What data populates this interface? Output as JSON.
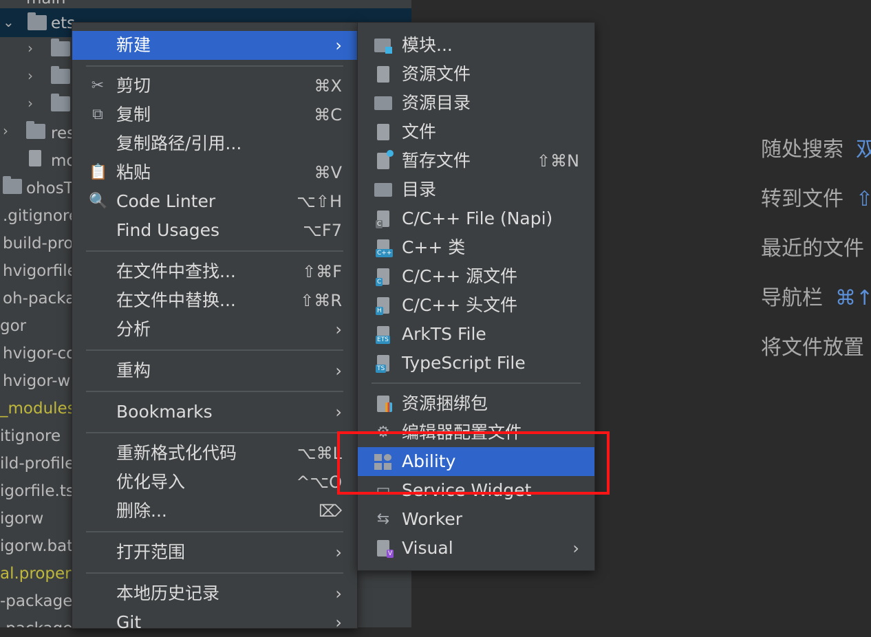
{
  "project_tree": {
    "items": [
      {
        "label": "main",
        "indent": 38,
        "folder": false
      },
      {
        "label": "ets",
        "indent": 74,
        "folder": true
      },
      {
        "label": "",
        "indent": 100,
        "folder": true
      },
      {
        "label": "",
        "indent": 100,
        "folder": true
      },
      {
        "label": "",
        "indent": 100,
        "folder": true
      },
      {
        "label": "res",
        "indent": 74,
        "folder": true
      },
      {
        "label": "mo",
        "indent": 74,
        "folder": false
      },
      {
        "label": "ohosT",
        "indent": 38,
        "folder": true
      },
      {
        "label": ".gitignore",
        "indent": 4,
        "folder": false
      },
      {
        "label": "build-pro",
        "indent": 4,
        "folder": false
      },
      {
        "label": "hvigorfile",
        "indent": 4,
        "folder": false
      },
      {
        "label": "oh-packa",
        "indent": 4,
        "folder": false
      },
      {
        "label": "gor",
        "indent": 0,
        "folder": false
      },
      {
        "label": "hvigor-co",
        "indent": 4,
        "folder": false
      },
      {
        "label": "hvigor-w",
        "indent": 4,
        "folder": false
      },
      {
        "label": "_modules",
        "indent": 0,
        "folder": false
      },
      {
        "label": "itignore",
        "indent": 0,
        "folder": false
      },
      {
        "label": "ild-profile",
        "indent": 0,
        "folder": false
      },
      {
        "label": "igorfile.ts",
        "indent": 0,
        "folder": false
      },
      {
        "label": "igorw",
        "indent": 0,
        "folder": false
      },
      {
        "label": "igorw.bat",
        "indent": 0,
        "folder": false
      },
      {
        "label": "al.proper",
        "indent": 0,
        "folder": false
      },
      {
        "label": "-package",
        "indent": 0,
        "folder": false
      },
      {
        "label": "-package",
        "indent": 0,
        "folder": false
      }
    ]
  },
  "editor_hints": [
    {
      "label": "随处搜索",
      "key": "双"
    },
    {
      "label": "转到文件",
      "key": "⇧"
    },
    {
      "label": "最近的文件",
      "key": ""
    },
    {
      "label": "导航栏",
      "key": "⌘↑"
    },
    {
      "label": "将文件放置",
      "key": ""
    }
  ],
  "context_menu": {
    "new_label": "新建",
    "cut_label": "剪切",
    "cut_shortcut": "⌘X",
    "copy_label": "复制",
    "copy_shortcut": "⌘C",
    "copy_path_label": "复制路径/引用...",
    "paste_label": "粘贴",
    "paste_shortcut": "⌘V",
    "code_linter_label": "Code Linter",
    "code_linter_shortcut": "⌥⇧H",
    "find_usages_label": "Find Usages",
    "find_usages_shortcut": "⌥F7",
    "find_in_files_label": "在文件中查找...",
    "find_in_files_shortcut": "⇧⌘F",
    "replace_in_files_label": "在文件中替换...",
    "replace_in_files_shortcut": "⇧⌘R",
    "analyze_label": "分析",
    "refactor_label": "重构",
    "bookmarks_label": "Bookmarks",
    "reformat_label": "重新格式化代码",
    "reformat_shortcut": "⌥⌘L",
    "optimize_imports_label": "优化导入",
    "optimize_imports_shortcut": "^⌥O",
    "delete_label": "删除...",
    "delete_shortcut": "⌦",
    "open_in_label": "打开范围",
    "local_history_label": "本地历史记录",
    "git_label": "Git"
  },
  "new_submenu": {
    "module_label": "模块...",
    "resource_file_label": "资源文件",
    "resource_dir_label": "资源目录",
    "file_label": "文件",
    "scratch_file_label": "暂存文件",
    "scratch_file_shortcut": "⇧⌘N",
    "directory_label": "目录",
    "cpp_napi_label": "C/C++ File (Napi)",
    "cpp_class_label": "C++ 类",
    "cpp_source_label": "C/C++ 源文件",
    "cpp_header_label": "C/C++ 头文件",
    "arkts_label": "ArkTS File",
    "typescript_label": "TypeScript File",
    "resource_bundle_label": "资源捆绑包",
    "editorconfig_label": "编辑器配置文件",
    "ability_label": "Ability",
    "service_widget_label": "Service Widget",
    "worker_label": "Worker",
    "visual_label": "Visual",
    "badges": {
      "cpp": "C++",
      "c": "C",
      "h": "H",
      "ets": "ETS",
      "ts": "TS",
      "v": "V"
    }
  },
  "colors": {
    "highlight": "#2f65ca",
    "annotation": "#ff1515",
    "menu_bg": "#3c3f41"
  }
}
